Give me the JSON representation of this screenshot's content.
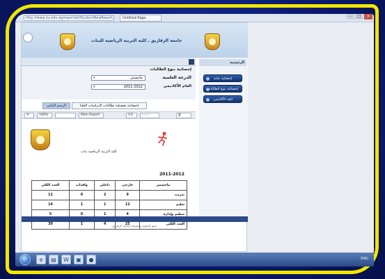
{
  "browser": {
    "address": "http://www.zu.edu.eg/reportall/StudentNewReport.aspx",
    "tab_title": "Untitled Page"
  },
  "site": {
    "banner_title": "جامعة الزقازيق ـ كلية التربية الرياضية للبنات"
  },
  "filters": {
    "section_title": "إحصائية بنوع الطالبات",
    "degree_label": "الدرجة العلمية",
    "degree_value": "ماجستير",
    "year_label": "العام الأكاديمي",
    "year_value": "2011-2012"
  },
  "tabs": [
    {
      "label": "الرسم البياني"
    },
    {
      "label": "إحصائية تفصيلية بطالبات الدراسات العليا"
    }
  ],
  "toolbar": {
    "zoom": "100%",
    "view": "Main Report",
    "page": "1/1"
  },
  "report": {
    "faculty_title": "كلية التربية الرياضية بنات",
    "year": "2011-2012",
    "headers": [
      "ماجستير",
      "خارجي",
      "داخلي",
      "وافدات",
      "العدد الكلي"
    ],
    "rows": [
      {
        "label": "تدريب",
        "values": [
          "9",
          "2",
          "0",
          "11"
        ]
      },
      {
        "label": "تعليم",
        "values": [
          "12",
          "1",
          "1",
          "14"
        ]
      },
      {
        "label": "تنظيم وإدارة",
        "values": [
          "4",
          "1",
          "0",
          "5"
        ]
      },
      {
        "label": "العدد الكلي",
        "values": [
          "25",
          "4",
          "1",
          "30"
        ]
      }
    ],
    "footer_text": "جميع الحقوق محفوظة لجامعة الزقازيق"
  },
  "sidebar": {
    "header": "الرئيسية",
    "buttons": [
      {
        "label": "إحصائية عامة"
      },
      {
        "label": "إحصائية بنوع الطالبات"
      },
      {
        "label": "الحد الأكاديمي"
      }
    ]
  },
  "taskbar": {
    "clock": "ENG"
  }
}
